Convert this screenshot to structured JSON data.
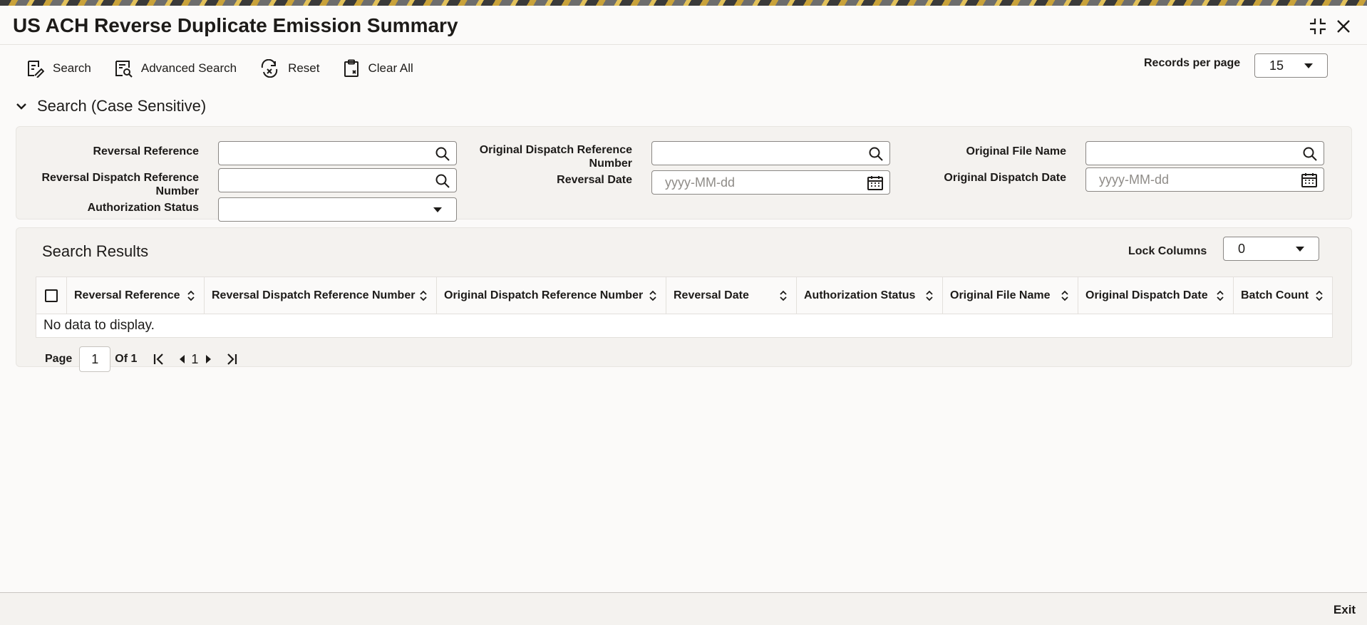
{
  "window": {
    "title": "US ACH Reverse Duplicate Emission Summary"
  },
  "toolbar": {
    "search_label": "Search",
    "advanced_search_label": "Advanced Search",
    "reset_label": "Reset",
    "clear_all_label": "Clear All"
  },
  "records_per_page": {
    "label": "Records per page",
    "value": "15"
  },
  "search_section": {
    "title": "Search (Case Sensitive)",
    "fields": {
      "reversal_reference": {
        "label": "Reversal Reference",
        "value": ""
      },
      "reversal_dispatch_reference_number": {
        "label_line1": "Reversal Dispatch Reference",
        "label_line2": "Number",
        "value": ""
      },
      "authorization_status": {
        "label": "Authorization Status",
        "value": ""
      },
      "original_dispatch_reference_number": {
        "label_line1": "Original Dispatch Reference",
        "label_line2": "Number",
        "value": ""
      },
      "reversal_date": {
        "label": "Reversal Date",
        "placeholder": "yyyy-MM-dd"
      },
      "original_file_name": {
        "label": "Original File Name",
        "value": ""
      },
      "original_dispatch_date": {
        "label": "Original Dispatch Date",
        "placeholder": "yyyy-MM-dd"
      }
    }
  },
  "results": {
    "title": "Search Results",
    "lock_columns": {
      "label": "Lock Columns",
      "value": "0"
    },
    "columns": [
      "Reversal Reference",
      "Reversal Dispatch Reference Number",
      "Original Dispatch Reference Number",
      "Reversal Date",
      "Authorization Status",
      "Original File Name",
      "Original Dispatch Date",
      "Batch Count"
    ],
    "empty_message": "No data to display."
  },
  "pagination": {
    "page_label": "Page",
    "current_page": "1",
    "of_label": "Of 1",
    "page_number": "1"
  },
  "footer": {
    "exit_label": "Exit"
  },
  "icons": {
    "collapse": "collapse-icon",
    "close": "close-icon",
    "search": "search-icon",
    "calendar": "calendar-icon",
    "sort": "sort-icon"
  }
}
